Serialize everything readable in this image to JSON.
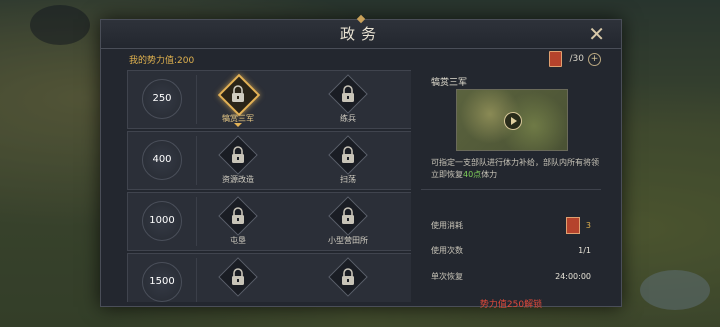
{
  "window": {
    "title": "政务"
  },
  "header": {
    "power_label": "我的势力值:200",
    "stamina_current": "",
    "stamina_max": "/30"
  },
  "tiers": [
    {
      "value": "250",
      "skills": [
        {
          "name": "犒赏三军",
          "selected": true
        },
        {
          "name": "练兵"
        }
      ]
    },
    {
      "value": "400",
      "skills": [
        {
          "name": "资源改造"
        },
        {
          "name": "扫荡"
        }
      ]
    },
    {
      "value": "1000",
      "skills": [
        {
          "name": "屯垦"
        },
        {
          "name": "小型营田所"
        }
      ]
    },
    {
      "value": "1500",
      "skills": [
        {
          "name": ""
        },
        {
          "name": ""
        }
      ]
    }
  ],
  "detail": {
    "title": "犒赏三军",
    "desc_pre": "可指定一支部队进行体力补给，部队内所有将领立即恢复",
    "desc_highlight": "40点",
    "desc_post": "体力",
    "cost_label": "使用消耗",
    "cost_value": "3",
    "uses_label": "使用次数",
    "uses_value": "1/1",
    "recover_label": "单次恢复",
    "recover_value": "24:00:00",
    "unlock_text": "势力值250解锁"
  },
  "colors": {
    "accent": "#e3b257",
    "warning": "#e04a3a",
    "highlight": "#7fd05a"
  }
}
